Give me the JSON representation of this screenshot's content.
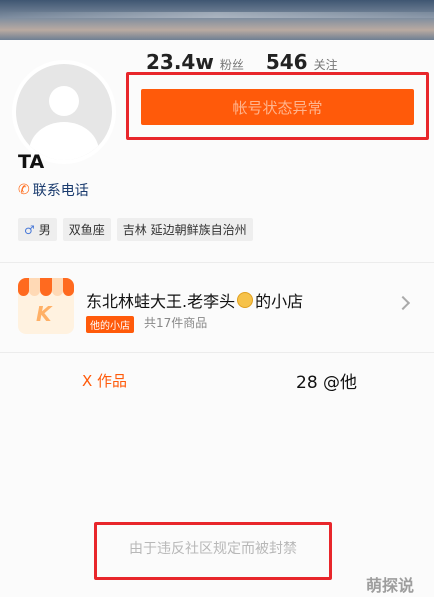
{
  "profile": {
    "followers_count": "23.4w",
    "followers_label": "粉丝",
    "following_count": "546",
    "following_label": "关注",
    "status_button": "帐号状态异常",
    "username": "TA",
    "contact_label": "联系电话",
    "tags": [
      "男",
      "双鱼座",
      "吉林 延边朝鲜族自治州"
    ]
  },
  "shop": {
    "name": "东北林蛙大王.老李头",
    "name_suffix": "的小店",
    "badge": "他的小店",
    "count": "共17件商品"
  },
  "tabs": {
    "works": "X 作品",
    "mentions": "28 @他"
  },
  "ban_notice": "由于违反社区规定而被封禁",
  "watermark": "萌探说",
  "colors": {
    "accent": "#ff5a0a",
    "highlight": "#e8262b"
  },
  "icons": [
    "phone-icon",
    "male-icon",
    "chevron-right-icon"
  ]
}
